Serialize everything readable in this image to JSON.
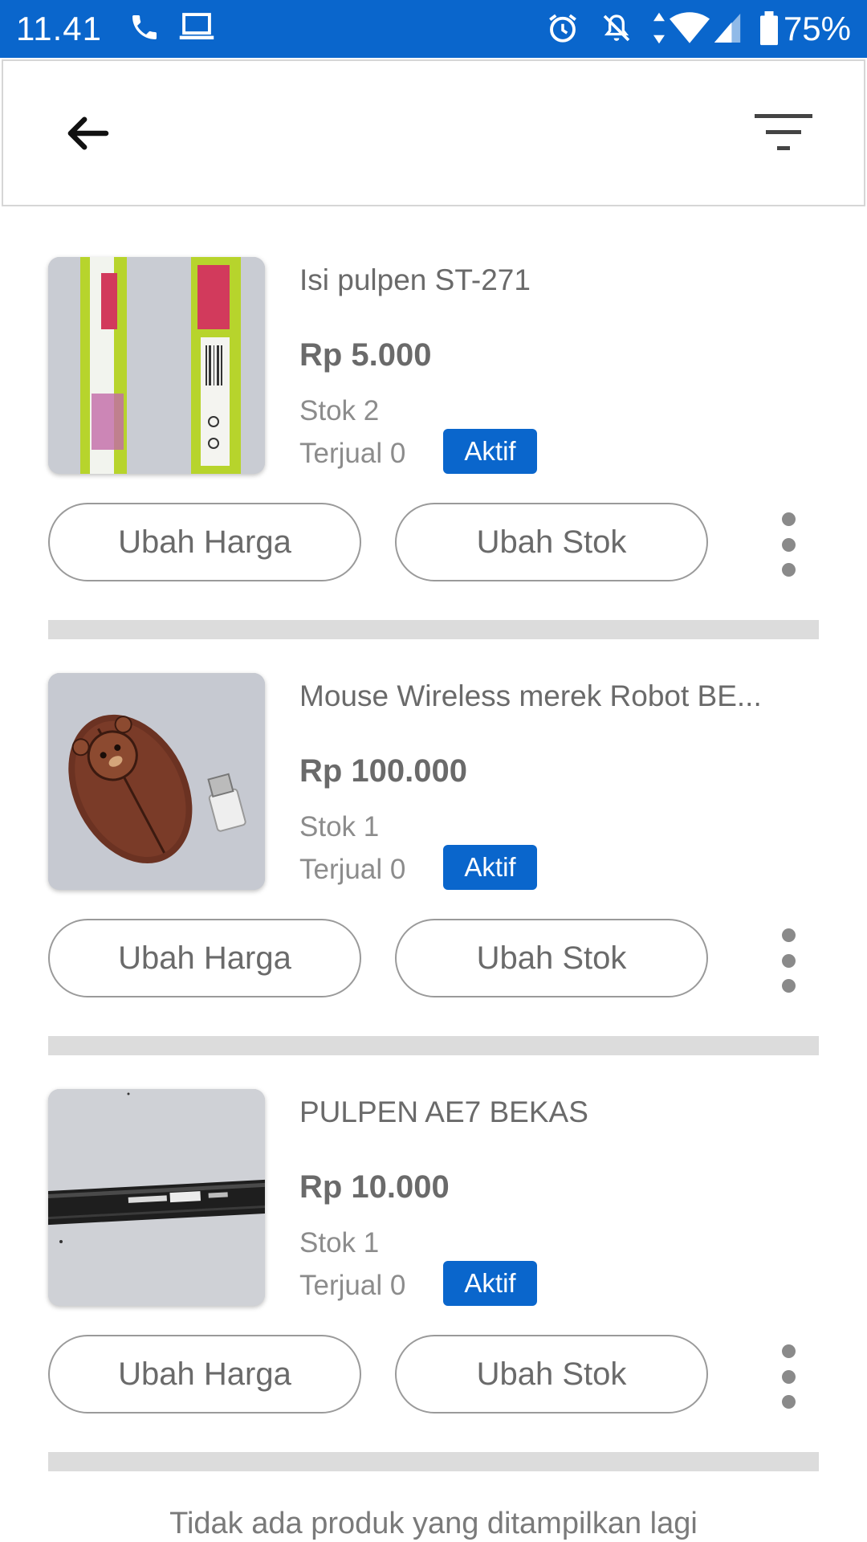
{
  "status_bar": {
    "time": "11.41",
    "battery": "75%",
    "icons": [
      "phone-icon",
      "laptop-icon",
      "alarm-icon",
      "notifications-off-icon",
      "data-arrows-icon",
      "wifi-icon",
      "signal-icon",
      "battery-icon"
    ]
  },
  "app_bar": {
    "back_icon": "arrow-left-icon",
    "filter_icon": "filter-icon"
  },
  "products": [
    {
      "name": "Isi pulpen ST-271",
      "price": "Rp 5.000",
      "stock": "Stok 2",
      "sold": "Terjual 0",
      "status": "Aktif",
      "edit_price_label": "Ubah Harga",
      "edit_stock_label": "Ubah Stok"
    },
    {
      "name": "Mouse Wireless merek Robot BE...",
      "price": "Rp 100.000",
      "stock": "Stok 1",
      "sold": "Terjual 0",
      "status": "Aktif",
      "edit_price_label": "Ubah Harga",
      "edit_stock_label": "Ubah Stok"
    },
    {
      "name": "PULPEN AE7 BEKAS",
      "price": "Rp 10.000",
      "stock": "Stok 1",
      "sold": "Terjual 0",
      "status": "Aktif",
      "edit_price_label": "Ubah Harga",
      "edit_stock_label": "Ubah Stok"
    }
  ],
  "footer_message": "Tidak ada produk yang ditampilkan lagi",
  "colors": {
    "primary": "#0a66cc",
    "text": "#6a6a6a",
    "muted": "#8c8c8c",
    "divider": "#dcdcdc"
  }
}
